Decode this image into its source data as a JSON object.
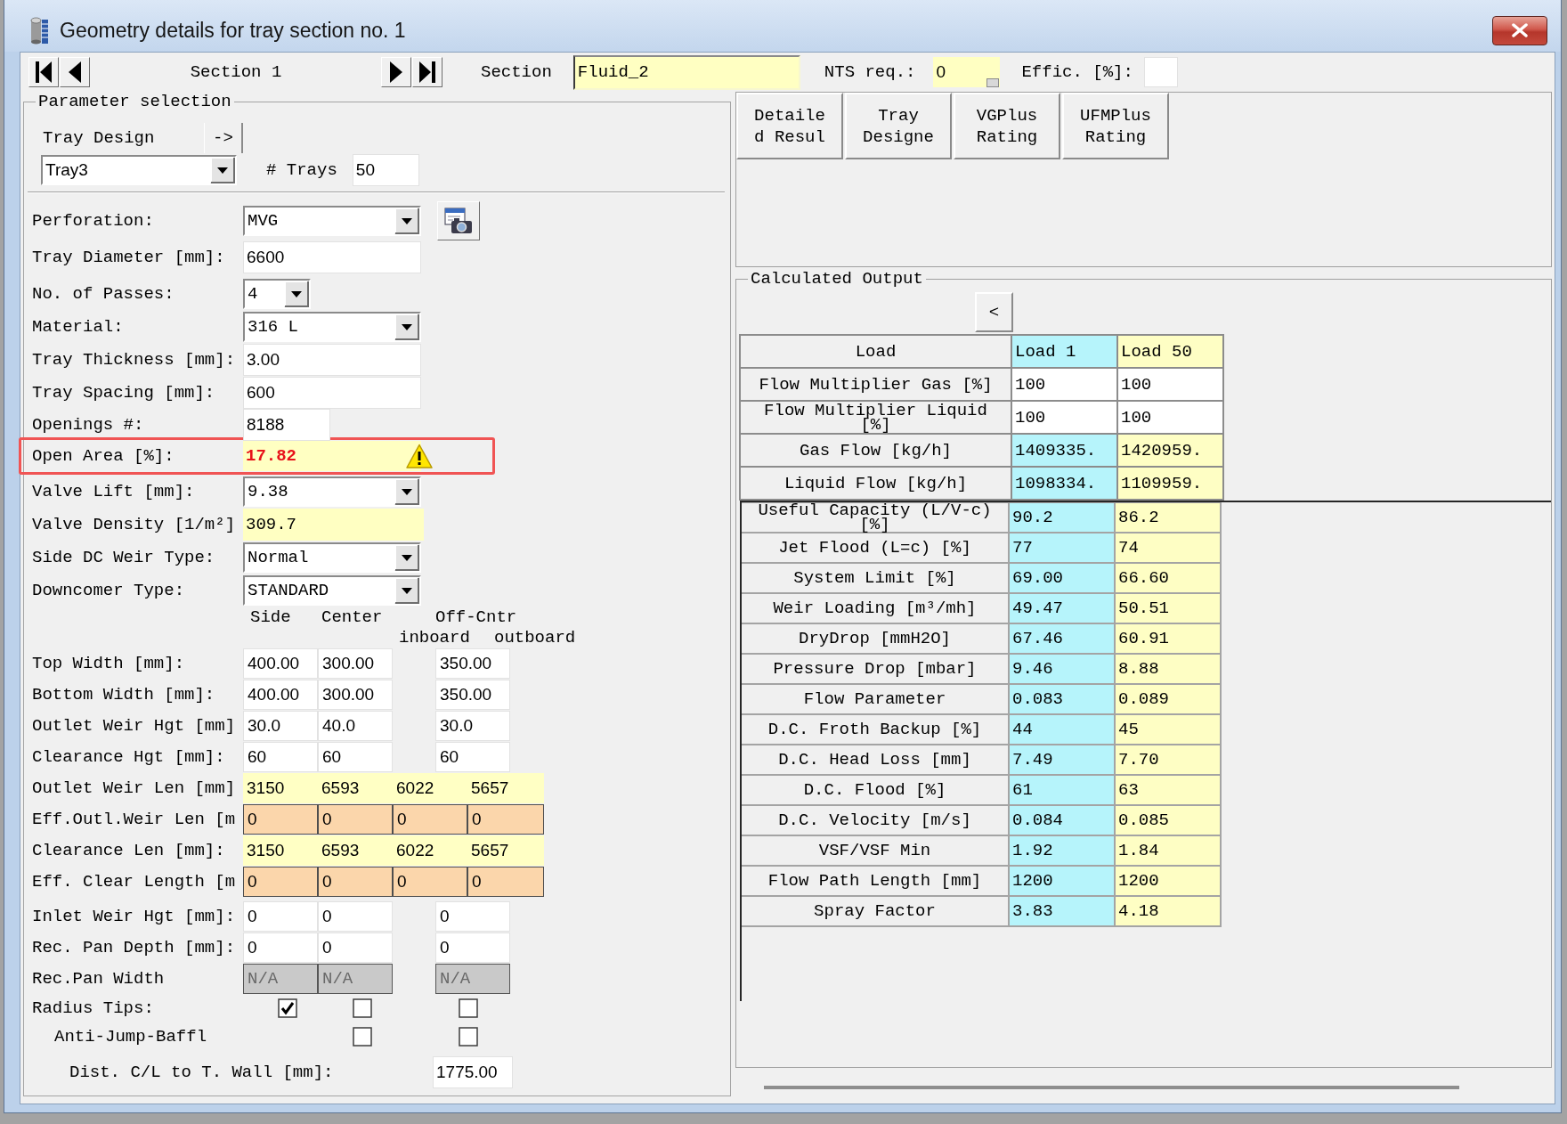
{
  "window": {
    "title": "Geometry details for tray section no. 1"
  },
  "navigator": {
    "label": "Section 1"
  },
  "header_fields": [
    {
      "label": "Section",
      "kind": "result",
      "value": "Fluid_2"
    },
    {
      "label": "NTS req.:",
      "kind": "spinner",
      "value": "0"
    },
    {
      "label": "Effic. [%]:",
      "kind": "entry"
    }
  ],
  "parameter_selection": {
    "title": "Parameter selection",
    "design": {
      "label": "Tray Design",
      "button": "->",
      "value": "Tray3"
    },
    "trays": {
      "label": "# Trays",
      "value": "50"
    },
    "fields": [
      {
        "label": "Perforation:",
        "kind": "browse",
        "value": "MVG"
      },
      {
        "label": "Tray Diameter [mm]:",
        "kind": "entry",
        "value": "6600"
      },
      {
        "label": "No. of Passes:",
        "kind": "picker",
        "value": "4"
      },
      {
        "label": "Material:",
        "kind": "dropdown",
        "value": "316 L"
      },
      {
        "label": "Tray Thickness [mm]:",
        "kind": "entry",
        "value": "3.00"
      },
      {
        "label": "Tray Spacing [mm]:",
        "kind": "entry",
        "value": "600"
      },
      {
        "label": "Openings #:",
        "kind": "counter",
        "value": "8188"
      },
      {
        "label": "Open Area [%]:",
        "kind": "alert",
        "value": "17.82"
      },
      {
        "label": "Valve Lift [mm]:",
        "kind": "dropdown",
        "value": "9.38"
      },
      {
        "label": "Valve Density [1/m²]",
        "kind": "result",
        "value": "309.7"
      },
      {
        "label": "Side DC Weir Type:",
        "kind": "dropdown",
        "value": "Normal"
      },
      {
        "label": "Downcomer Type:",
        "kind": "dropdown",
        "value": "STANDARD"
      }
    ],
    "geometry": {
      "columns": [
        "Side",
        "Center",
        "Off-Cntr"
      ],
      "subcolumns": [
        "inboard",
        "outboard"
      ],
      "rows": [
        {
          "label": "Top Width [mm]:",
          "kind": "entry",
          "values": [
            "400.00",
            "300.00",
            "350.00"
          ]
        },
        {
          "label": "Bottom Width [mm]:",
          "kind": "entry",
          "values": [
            "400.00",
            "300.00",
            "350.00"
          ]
        },
        {
          "label": "Outlet Weir Hgt [mm]",
          "kind": "entry",
          "values": [
            "30.0",
            "40.0",
            "30.0"
          ]
        },
        {
          "label": "Clearance Hgt [mm]:",
          "kind": "entry",
          "values": [
            "60",
            "60",
            "60"
          ]
        },
        {
          "label": "Outlet Weir Len [mm]",
          "kind": "result",
          "values": [
            "3150",
            "6593",
            "6022",
            "5657"
          ]
        },
        {
          "label": "Eff.Outl.Weir Len [m",
          "kind": "computed",
          "values": [
            "0",
            "0",
            "0",
            "0"
          ]
        },
        {
          "label": "Clearance Len [mm]:",
          "kind": "result",
          "values": [
            "3150",
            "6593",
            "6022",
            "5657"
          ]
        },
        {
          "label": "Eff. Clear Length [m",
          "kind": "computed",
          "values": [
            "0",
            "0",
            "0",
            "0"
          ]
        },
        {
          "label": "Inlet Weir Hgt [mm]:",
          "kind": "entry",
          "values": [
            "0",
            "0",
            "0"
          ]
        },
        {
          "label": "Rec. Pan Depth [mm]:",
          "kind": "entry",
          "values": [
            "0",
            "0",
            "0"
          ]
        },
        {
          "label": "Rec.Pan Width",
          "kind": "disabled",
          "values": [
            "N/A",
            "N/A",
            "N/A"
          ]
        },
        {
          "label": "Radius Tips:",
          "kind": "checks",
          "checks": [
            {
              "checked": true
            },
            {
              "checked": false
            },
            {
              "checked": false
            }
          ]
        },
        {
          "label": "Anti-Jump-Baffl",
          "kind": "subchecks",
          "checks": [
            {
              "checked": false
            },
            {
              "checked": false
            }
          ]
        }
      ]
    },
    "distance": {
      "label": "Dist. C/L to T. Wall [mm]:",
      "value": "1775.00"
    }
  },
  "result_buttons": [
    "Detailed Resul",
    "Tray Designe",
    "VGPlus Rating",
    "UFMPlus Rating"
  ],
  "calculated_output": {
    "title": "Calculated Output",
    "button": "<",
    "corner": "Load",
    "columns": [
      {
        "label": "Load 1",
        "color": "#b6f4fb"
      },
      {
        "label": "Load 50",
        "color": "#fefec4"
      }
    ],
    "multipliers": [
      {
        "label": "Flow Multiplier Gas [%]",
        "values": [
          "100",
          "100"
        ]
      },
      {
        "label": "Flow Multiplier Liquid [%]",
        "values": [
          "100",
          "100"
        ]
      }
    ],
    "flows": [
      {
        "label": "Gas Flow [kg/h]",
        "values": [
          "1409335.",
          "1420959."
        ]
      },
      {
        "label": "Liquid Flow [kg/h]",
        "values": [
          "1098334.",
          "1109959."
        ]
      }
    ],
    "results": [
      {
        "label": "Useful Capacity (L/V-c) [%]",
        "values": [
          "90.2",
          "86.2"
        ]
      },
      {
        "label": "Jet Flood (L=c) [%]",
        "values": [
          "77",
          "74"
        ]
      },
      {
        "label": "System Limit [%]",
        "values": [
          "69.00",
          "66.60"
        ]
      },
      {
        "label": "Weir Loading [m³/mh]",
        "values": [
          "49.47",
          "50.51"
        ]
      },
      {
        "label": "DryDrop [mmH2O]",
        "values": [
          "67.46",
          "60.91"
        ]
      },
      {
        "label": "Pressure Drop [mbar]",
        "values": [
          "9.46",
          "8.88"
        ]
      },
      {
        "label": "Flow Parameter",
        "values": [
          "0.083",
          "0.089"
        ]
      },
      {
        "label": "D.C. Froth Backup [%]",
        "values": [
          "44",
          "45"
        ]
      },
      {
        "label": "D.C. Head Loss [mm]",
        "values": [
          "7.49",
          "7.70"
        ]
      },
      {
        "label": "D.C. Flood [%]",
        "values": [
          "61",
          "63"
        ]
      },
      {
        "label": "D.C. Velocity [m/s]",
        "values": [
          "0.084",
          "0.085"
        ]
      },
      {
        "label": "VSF/VSF Min",
        "values": [
          "1.92",
          "1.84"
        ]
      },
      {
        "label": "Flow Path Length [mm]",
        "values": [
          "1200",
          "1200"
        ]
      },
      {
        "label": "Spray Factor",
        "values": [
          "3.83",
          "4.18"
        ]
      }
    ]
  }
}
